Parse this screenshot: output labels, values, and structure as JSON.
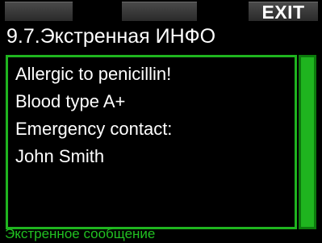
{
  "softkeys": {
    "left": "",
    "middle": "",
    "right": "EXIT"
  },
  "title": "9.7.Экстренная ИНФО",
  "content": {
    "lines": [
      "Allergic to penicillin!",
      "Blood type A+",
      "Emergency contact:",
      "John Smith"
    ]
  },
  "footer": "Экстренное сообщение",
  "colors": {
    "accent": "#1fb41f",
    "footer_text": "#21c021",
    "background": "#000000",
    "text": "#ffffff"
  }
}
